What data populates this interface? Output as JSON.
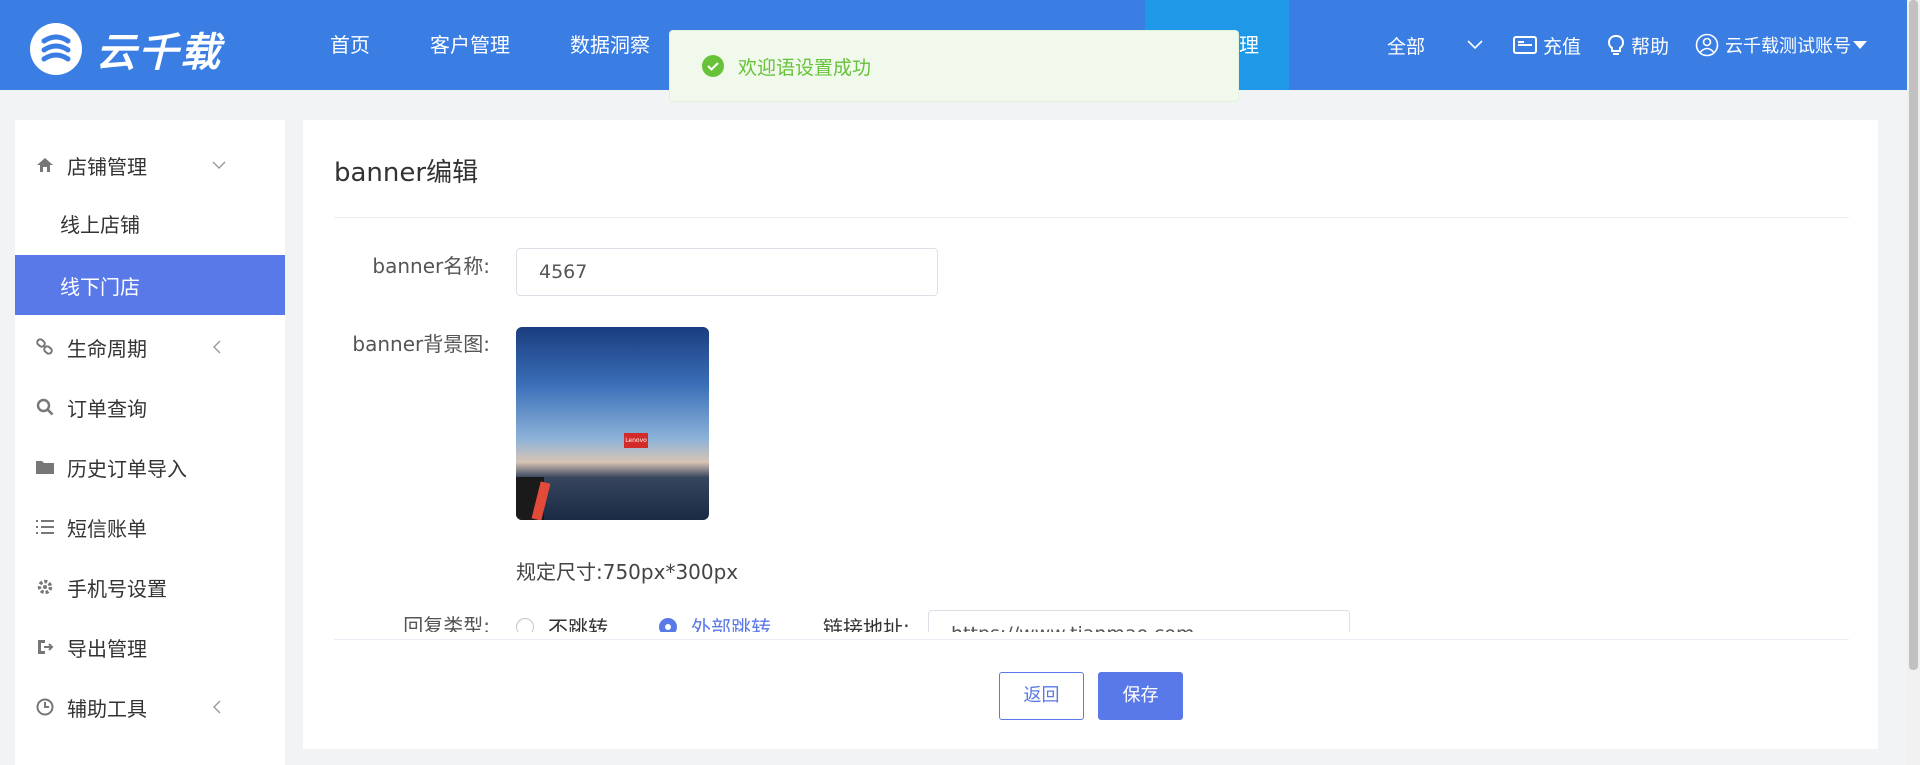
{
  "app": {
    "logo_text": "云千载"
  },
  "nav": {
    "items": [
      "首页",
      "客户管理",
      "数据洞察"
    ],
    "active_partial": "理"
  },
  "topright": {
    "scope": "全部",
    "recharge": "充值",
    "help": "帮助",
    "account": "云千载测试账号"
  },
  "toast": {
    "message": "欢迎语设置成功"
  },
  "sidebar": {
    "items": [
      {
        "label": "店铺管理",
        "icon": "home-icon"
      },
      {
        "label": "线上店铺"
      },
      {
        "label": "线下门店"
      },
      {
        "label": "生命周期",
        "icon": "link-icon"
      },
      {
        "label": "订单查询",
        "icon": "search-icon"
      },
      {
        "label": "历史订单导入",
        "icon": "folder-icon"
      },
      {
        "label": "短信账单",
        "icon": "list-icon"
      },
      {
        "label": "手机号设置",
        "icon": "gear-icon"
      },
      {
        "label": "导出管理",
        "icon": "export-icon"
      },
      {
        "label": "辅助工具",
        "icon": "clock-icon"
      }
    ]
  },
  "form": {
    "title": "banner编辑",
    "name_label": "banner名称:",
    "name_value": "4567",
    "bg_label": "banner背景图:",
    "image_sign_text": "Lenovo",
    "size_hint": "规定尺寸:750px*300px",
    "jump_label": "回复类型:",
    "radio_no_jump": "不跳转",
    "radio_external": "外部跳转",
    "link_label": "链接地址:",
    "link_value": "https://www.tianmao.com"
  },
  "buttons": {
    "back": "返回",
    "save": "保存"
  },
  "colors": {
    "topbar": "#3a7ee4",
    "accent": "#5a79e8",
    "success": "#67c23a"
  }
}
